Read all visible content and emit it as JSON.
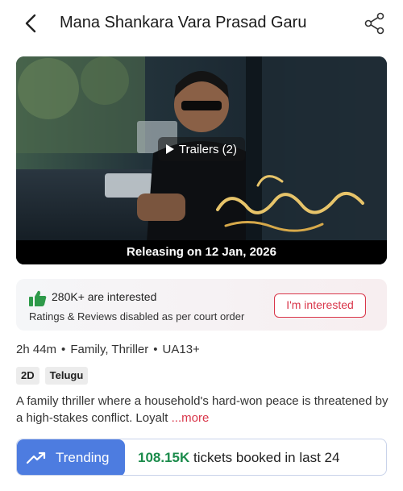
{
  "header": {
    "title": "Mana Shankara Vara Prasad Garu",
    "back_icon": "chevron-left-icon",
    "share_icon": "share-icon"
  },
  "poster": {
    "trailer_label": "Trailers (2)",
    "release_text": "Releasing on 12 Jan, 2026"
  },
  "interest": {
    "count_text": "280K+ are interested",
    "note": "Ratings & Reviews disabled as per court order",
    "button_label": "I'm interested",
    "accent": "#d9364a"
  },
  "meta": {
    "duration": "2h 44m",
    "genres": "Family, Thriller",
    "rating": "UA13+",
    "separator": "•"
  },
  "tags": [
    "2D",
    "Telugu"
  ],
  "description": {
    "text": "A family thriller where a household's hard-won peace is threatened by a high-stakes conflict. Loyalt",
    "more": " ...more"
  },
  "trending": {
    "label": "Trending",
    "count": "108.15K",
    "suffix": " tickets booked in last 24",
    "colors": {
      "pill": "#4d7ce0",
      "count": "#1b8b4b"
    }
  }
}
